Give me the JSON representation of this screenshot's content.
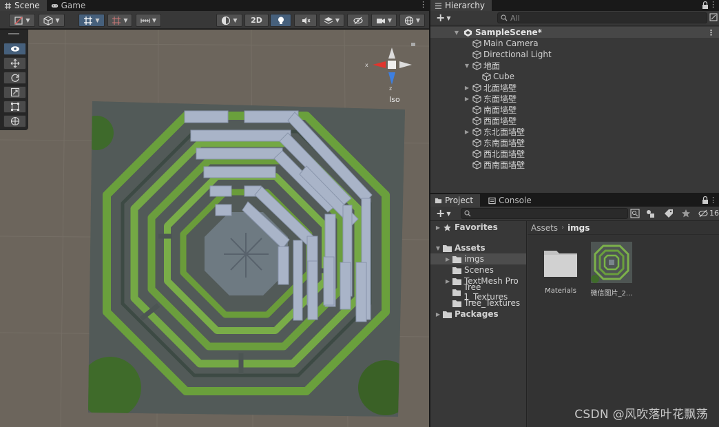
{
  "scene_tabs": [
    {
      "label": "Scene",
      "icon": "grid-icon",
      "active": true
    },
    {
      "label": "Game",
      "icon": "gamepad-icon",
      "active": false
    }
  ],
  "scene_toolbar": {
    "mode_2d_label": "2D",
    "gizmo_label": "Iso"
  },
  "tools": [
    "view-tool",
    "move-tool",
    "rotate-tool",
    "scale-tool",
    "rect-tool",
    "transform-tool"
  ],
  "hierarchy": {
    "tab_label": "Hierarchy",
    "search_placeholder": "All",
    "scene_name": "SampleScene*",
    "items": [
      {
        "label": "Main Camera",
        "indent": 1,
        "expandable": false
      },
      {
        "label": "Directional Light",
        "indent": 1,
        "expandable": false
      },
      {
        "label": "地面",
        "indent": 1,
        "expandable": true,
        "expanded": true
      },
      {
        "label": "Cube",
        "indent": 2,
        "expandable": false
      },
      {
        "label": "北面墙壁",
        "indent": 1,
        "expandable": true,
        "expanded": false
      },
      {
        "label": "东面墙壁",
        "indent": 1,
        "expandable": true,
        "expanded": false
      },
      {
        "label": "南面墙壁",
        "indent": 1,
        "expandable": false
      },
      {
        "label": "西面墙壁",
        "indent": 1,
        "expandable": false
      },
      {
        "label": "东北面墙壁",
        "indent": 1,
        "expandable": true,
        "expanded": false
      },
      {
        "label": "东南面墙壁",
        "indent": 1,
        "expandable": false
      },
      {
        "label": "西北面墙壁",
        "indent": 1,
        "expandable": false
      },
      {
        "label": "西南面墙壁",
        "indent": 1,
        "expandable": false
      }
    ]
  },
  "project": {
    "tabs": [
      {
        "label": "Project",
        "active": true
      },
      {
        "label": "Console",
        "active": false
      }
    ],
    "hidden_count": "16",
    "tree": [
      {
        "label": "Favorites",
        "indent": 0,
        "arrow": "right",
        "icon": "star",
        "bold": true
      },
      {
        "label": "Assets",
        "indent": 0,
        "arrow": "down",
        "icon": "folder",
        "bold": true
      },
      {
        "label": "imgs",
        "indent": 1,
        "arrow": "right",
        "icon": "folder",
        "selected": true
      },
      {
        "label": "Scenes",
        "indent": 1,
        "arrow": "",
        "icon": "folder"
      },
      {
        "label": "TextMesh Pro",
        "indent": 1,
        "arrow": "right",
        "icon": "folder"
      },
      {
        "label": "Tree 1_Textures",
        "indent": 1,
        "arrow": "",
        "icon": "folder"
      },
      {
        "label": "Tree_Textures",
        "indent": 1,
        "arrow": "",
        "icon": "folder"
      },
      {
        "label": "Packages",
        "indent": 0,
        "arrow": "right",
        "icon": "folder",
        "bold": true
      }
    ],
    "breadcrumb": [
      "Assets",
      "imgs"
    ],
    "assets": [
      {
        "label": "Materials",
        "type": "folder"
      },
      {
        "label": "微信图片_2...",
        "type": "image"
      }
    ]
  },
  "watermark": "CSDN @风吹落叶花飘荡",
  "colors": {
    "selection_blue": "#46607c",
    "wall_color": "#a9b4c8",
    "hedge_green": "#5d8a35"
  }
}
